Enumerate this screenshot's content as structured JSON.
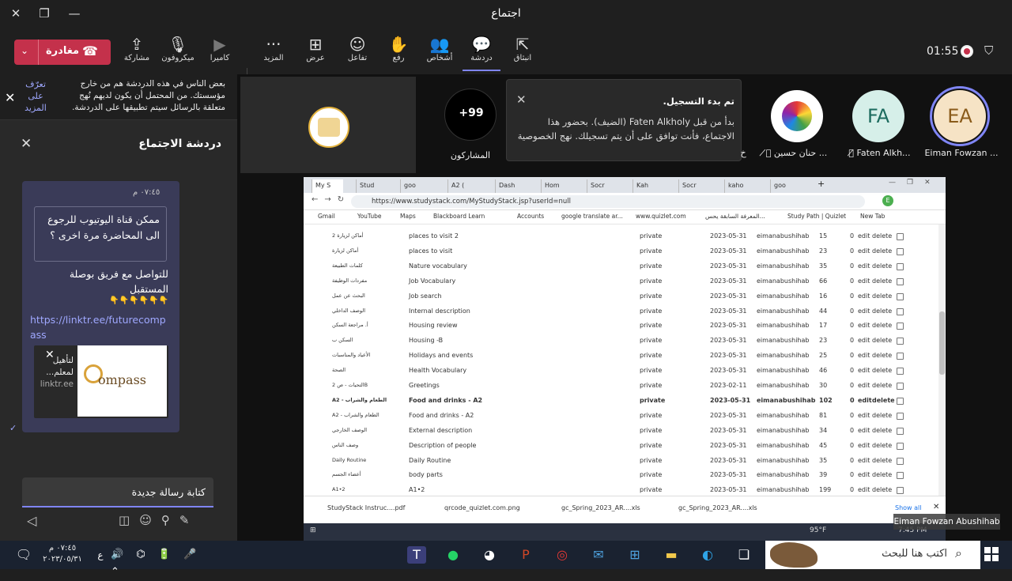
{
  "window": {
    "title": "اجتماع"
  },
  "toolbar": {
    "leave_label": "مغادرة",
    "buttons": [
      {
        "label": "مشاركة",
        "icon": "share-icon"
      },
      {
        "label": "ميكروفون",
        "icon": "mic-off-icon"
      },
      {
        "label": "كاميرا",
        "icon": "camera-off-icon"
      },
      {
        "label": "المزيد",
        "icon": "more-icon"
      },
      {
        "label": "عرض",
        "icon": "view-icon"
      },
      {
        "label": "تفاعل",
        "icon": "react-icon"
      },
      {
        "label": "رفع",
        "icon": "raise-hand-icon"
      },
      {
        "label": "أشخاص",
        "icon": "people-icon"
      },
      {
        "label": "دردشة",
        "icon": "chat-icon"
      },
      {
        "label": "انبثاق",
        "icon": "popout-icon"
      }
    ],
    "timer": "01:55"
  },
  "chat": {
    "notice": "بعض الناس في هذه الدردشة هم من خارج مؤسستك. من المحتمل أن يكون لديهم نُهج متعلقة بالرسائل سيتم تطبيقها على الدردشة.",
    "notice_link": "تعرّف على المزيد",
    "title": "دردشة الاجتماع",
    "message": {
      "time": "٠٧:٤٥ م",
      "quote": "ممكن قناة اليوتيوب للرجوع الى المحاضرة مرة اخرى ؟",
      "text": "للتواصل مع فريق بوصلة المستقبل",
      "link": "https://linktr.ee/futurecompass",
      "card_title": "لتأهيل لمعلم...",
      "card_domain": "linktr.ee"
    },
    "input_placeholder": "كتابة رسالة جديدة"
  },
  "stage": {
    "participants_count": "+99",
    "participants_label": "المشاركون",
    "recording_title": "تم بدء التسجيل.",
    "recording_body": "بدأ من قبل Faten Alkholy (الضيف). بحضور هذا الاجتماع، فأنت توافق على أن يتم تسجيلك. نهج الخصوصية",
    "participants": [
      {
        "initials": "EA",
        "name": "Eiman Fowzan ..."
      },
      {
        "initials": "FA",
        "name": "Faten Alkh..."
      },
      {
        "initials": "",
        "name": "حنان حسين ..."
      },
      {
        "initials": "",
        "name": "خ"
      }
    ]
  },
  "browser": {
    "tabs": [
      "My S",
      "Stud",
      "goo",
      "A2 (",
      "Dash",
      "Hom",
      "Socr",
      "Kah",
      "Socr",
      "kaho",
      "goo"
    ],
    "url": "https://www.studystack.com/MyStudyStack.jsp?userId=null",
    "bookmarks": [
      "Gmail",
      "YouTube",
      "Maps",
      "Blackboard Learn",
      "Accounts",
      "google translate ar...",
      "www.quizlet.com",
      "المعرفة السابقة يحس...",
      "Study Path | Quizlet",
      "New Tab"
    ],
    "rows": [
      {
        "ar": "أماكن لزيارة 2",
        "name": "places to visit 2",
        "priv": "private",
        "date": "2023-05-31",
        "user": "eimanabushihab",
        "n": "15",
        "z": "0"
      },
      {
        "ar": "أماكن لزيارة",
        "name": "places to visit",
        "priv": "private",
        "date": "2023-05-31",
        "user": "eimanabushihab",
        "n": "23",
        "z": "0"
      },
      {
        "ar": "كلمات الطبيعة",
        "name": "Nature vocabulary",
        "priv": "private",
        "date": "2023-05-31",
        "user": "eimanabushihab",
        "n": "35",
        "z": "0"
      },
      {
        "ar": "مفردات الوظيفة",
        "name": "Job Vocabulary",
        "priv": "private",
        "date": "2023-05-31",
        "user": "eimanabushihab",
        "n": "66",
        "z": "0"
      },
      {
        "ar": "البحث عن عمل",
        "name": "Job search",
        "priv": "private",
        "date": "2023-05-31",
        "user": "eimanabushihab",
        "n": "16",
        "z": "0"
      },
      {
        "ar": "الوصف الداخلي",
        "name": "Internal description",
        "priv": "private",
        "date": "2023-05-31",
        "user": "eimanabushihab",
        "n": "44",
        "z": "0"
      },
      {
        "ar": "أ. مراجعة السكن",
        "name": "Housing review",
        "priv": "private",
        "date": "2023-05-31",
        "user": "eimanabushihab",
        "n": "17",
        "z": "0"
      },
      {
        "ar": "السكن ب",
        "name": "Housing -B",
        "priv": "private",
        "date": "2023-05-31",
        "user": "eimanabushihab",
        "n": "23",
        "z": "0"
      },
      {
        "ar": "الأعياد والمناسبات",
        "name": "Holidays and events",
        "priv": "private",
        "date": "2023-05-31",
        "user": "eimanabushihab",
        "n": "25",
        "z": "0"
      },
      {
        "ar": "الصحة",
        "name": "Health Vocabulary",
        "priv": "private",
        "date": "2023-05-31",
        "user": "eimanabushihab",
        "n": "46",
        "z": "0"
      },
      {
        "ar": "التحيات - ص 2B",
        "name": "Greetings",
        "priv": "private",
        "date": "2023-02-11",
        "user": "eimanabushihab",
        "n": "30",
        "z": "0"
      },
      {
        "ar": "A2 - الطعام والشراب",
        "name": "Food and drinks - A2",
        "priv": "private",
        "date": "2023-05-31",
        "user": "eimanabushihab",
        "n": "102",
        "z": "0",
        "bold": true
      },
      {
        "ar": "A2 - الطعام والشراب",
        "name": "Food and drinks - A2",
        "priv": "private",
        "date": "2023-05-31",
        "user": "eimanabushihab",
        "n": "81",
        "z": "0"
      },
      {
        "ar": "الوصف الخارجي",
        "name": "External description",
        "priv": "private",
        "date": "2023-05-31",
        "user": "eimanabushihab",
        "n": "34",
        "z": "0"
      },
      {
        "ar": "وصف الناس",
        "name": "Description of people",
        "priv": "private",
        "date": "2023-05-31",
        "user": "eimanabushihab",
        "n": "45",
        "z": "0"
      },
      {
        "ar": "Daily Routine",
        "name": "Daily Routine",
        "priv": "private",
        "date": "2023-05-31",
        "user": "eimanabushihab",
        "n": "35",
        "z": "0"
      },
      {
        "ar": "أعضاء الجسم",
        "name": "body parts",
        "priv": "private",
        "date": "2023-05-31",
        "user": "eimanabushihab",
        "n": "39",
        "z": "0"
      },
      {
        "ar": "A1•2",
        "name": "A1•2",
        "priv": "private",
        "date": "2023-05-31",
        "user": "eimanabushihab",
        "n": "199",
        "z": "0"
      }
    ],
    "edit": "edit",
    "delete": "delete",
    "downloads": [
      "StudyStack Instruc....pdf",
      "qrcode_quizlet.com.png",
      "gc_Spring_2023_AR....xls",
      "gc_Spring_2023_AR....xls"
    ],
    "show_all": "Show all",
    "inner_clock": "7:45 PM",
    "inner_weather": "95°F"
  },
  "presenter_name": "Eiman Fowzan Abushihab",
  "taskbar": {
    "search_placeholder": "اكتب هنا للبحث",
    "time": "٠٧:٤٥ م",
    "date": "٢٠٢٣/٠٥/٣١",
    "lang": "ع"
  }
}
